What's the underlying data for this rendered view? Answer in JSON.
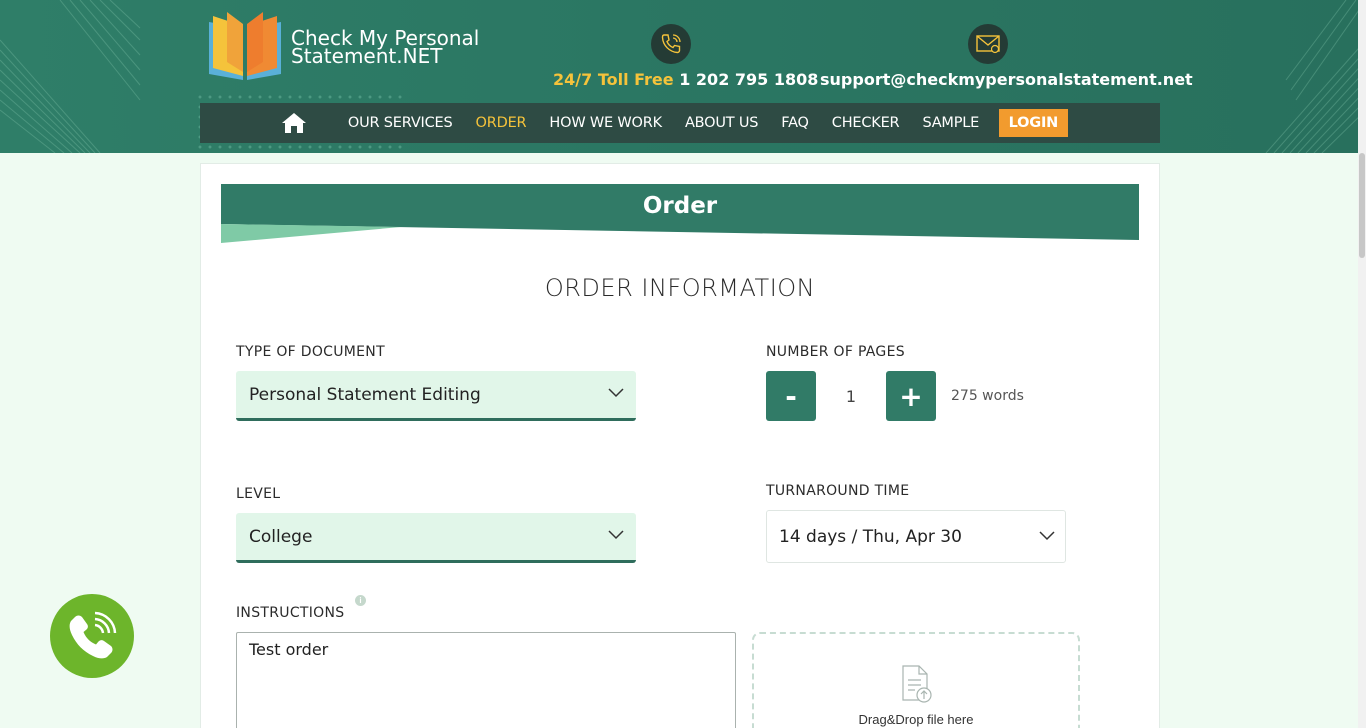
{
  "header": {
    "brand_line1": "Check My Personal",
    "brand_line2": "Statement.NET",
    "phone_prefix": "24/7 Toll Free",
    "phone_number": "1 202 795 1808",
    "email": "support@checkmypersonalstatement.net"
  },
  "nav": {
    "items": [
      "OUR SERVICES",
      "ORDER",
      "HOW WE WORK",
      "ABOUT US",
      "FAQ",
      "CHECKER",
      "SAMPLE"
    ],
    "active": "ORDER",
    "login": "LOGIN"
  },
  "page": {
    "banner_title": "Order",
    "section_title": "ORDER INFORMATION"
  },
  "form": {
    "type_label": "TYPE OF DOCUMENT",
    "type_value": "Personal Statement Editing",
    "pages_label": "NUMBER OF PAGES",
    "minus": "-",
    "plus": "+",
    "pages_value": "1",
    "words": "275 words",
    "level_label": "LEVEL",
    "level_value": "College",
    "turnaround_label": "TURNAROUND TIME",
    "turnaround_value": "14 days / Thu, Apr 30",
    "instructions_label": "INSTRUCTIONS",
    "instructions_info": "i",
    "instructions_value": "Test order",
    "dropzone_text": "Drag&Drop file here"
  },
  "colors": {
    "header": "#2b7763",
    "nav": "#2e4b44",
    "accent": "#f5c33b",
    "login": "#f29b2e",
    "primary": "#317b67",
    "call_button": "#6db52b"
  }
}
